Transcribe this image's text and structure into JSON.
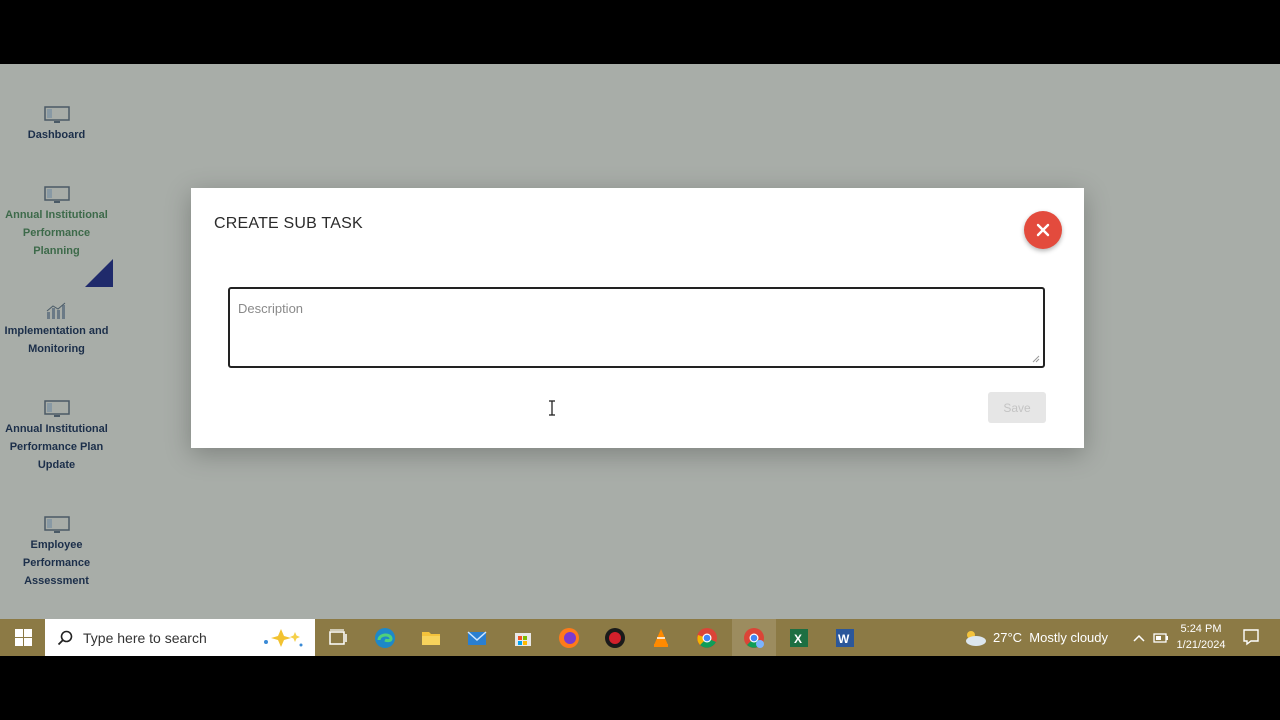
{
  "sidebar": {
    "items": [
      {
        "label": "Dashboard",
        "icon": "monitor-icon"
      },
      {
        "label": "Annual Institutional Performance Planning",
        "icon": "monitor-icon",
        "active": true
      },
      {
        "label": "Implementation and Monitoring",
        "icon": "bar-chart-icon"
      },
      {
        "label": "Annual Institutional Performance Plan Update",
        "icon": "monitor-icon"
      },
      {
        "label": "Employee Performance Assessment",
        "icon": "monitor-icon"
      }
    ]
  },
  "modal": {
    "title": "CREATE SUB TASK",
    "close_icon": "close-icon",
    "description_placeholder": "Description",
    "description_value": "",
    "save_label": "Save"
  },
  "taskbar": {
    "search_placeholder": "Type here to search",
    "apps": [
      "task-view-icon",
      "edge-icon",
      "file-explorer-icon",
      "mail-icon",
      "store-icon",
      "firefox-icon",
      "app-red-icon",
      "vlc-icon",
      "chrome-icon",
      "chrome-profile-icon",
      "excel-icon",
      "word-icon"
    ],
    "weather": "27°C  Mostly cloudy",
    "time": "5:24 PM",
    "date": "1/21/2024"
  },
  "colors": {
    "backdrop": "#a8ada8",
    "close_button": "#e34b3d",
    "active_flag": "#1f2a6b",
    "taskbar": "#8c7a45"
  }
}
